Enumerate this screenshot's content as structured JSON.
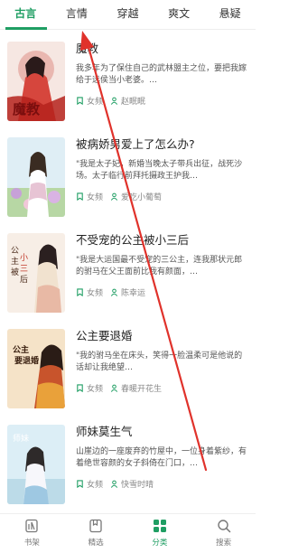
{
  "tabs": [
    {
      "label": "古言",
      "active": true
    },
    {
      "label": "言情",
      "active": false
    },
    {
      "label": "穿越",
      "active": false
    },
    {
      "label": "爽文",
      "active": false
    },
    {
      "label": "悬疑",
      "active": false
    }
  ],
  "colors": {
    "accent": "#1f9e63",
    "annotation_arrow": "#e0322b"
  },
  "books": [
    {
      "title": "魔教",
      "cover_text": "魔教",
      "description": "我多年为了保住自己的武林盟主之位，要把我嫁给于远侯当小老婆。…",
      "category": "女频",
      "author": "赵眠眠"
    },
    {
      "title": "被病娇男爱上了怎么办?",
      "cover_text": "",
      "description": "\"我是太子妃，新婚当晚太子带兵出征，战死沙场。太子临行前拜托摄政王护我…",
      "category": "女频",
      "author": "爱吃小葡萄"
    },
    {
      "title": "不受宠的公主被小三后",
      "cover_text": "公主被小三后",
      "description": "\"我是大运国最不受宠的三公主，连我那状元郎的驸马在父王面前比我有颜面，…",
      "category": "女频",
      "author": "陈幸运"
    },
    {
      "title": "公主要退婚",
      "cover_text": "公主要退婚",
      "description": "\"我的驸马坐在床头，笑得一脸温柔可是他说的话却让我绝望…",
      "category": "女频",
      "author": "春暖开花生"
    },
    {
      "title": "师妹莫生气",
      "cover_text": "师妹莫生气",
      "description": "山崖边的一座废弃的竹屋中，一位身着紫纱，有着绝世容颜的女子斜倚在门口，…",
      "category": "女频",
      "author": "快雪时晴"
    }
  ],
  "bottom_nav": [
    {
      "label": "书架",
      "icon": "bookshelf-icon",
      "active": false
    },
    {
      "label": "精选",
      "icon": "book-open-icon",
      "active": false
    },
    {
      "label": "分类",
      "icon": "category-grid-icon",
      "active": true
    },
    {
      "label": "搜索",
      "icon": "search-icon",
      "active": false
    }
  ]
}
